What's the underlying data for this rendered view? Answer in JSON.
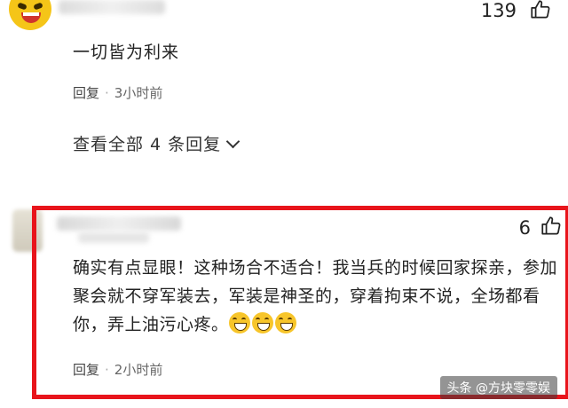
{
  "comments": [
    {
      "text": "一切皆为利来",
      "likes": "139",
      "reply_label": "回复",
      "time": "3小时前",
      "view_all": "查看全部 4 条回复"
    },
    {
      "text": "确实有点显眼！这种场合不适合！我当兵的时候回家探亲，参加聚会就不穿军装去，军装是神圣的，穿着拘束不说，全场都看你，弄上油污心疼。",
      "likes": "6",
      "reply_label": "回复",
      "time": "2小时前",
      "emoji_count": 3
    }
  ],
  "watermark": "头条 @方块零零娱",
  "colors": {
    "highlight": "#e8141b",
    "avatar_1": "#f5c518"
  },
  "icons": [
    "like-icon",
    "emoji-grin-icon",
    "chevron-down-icon"
  ]
}
